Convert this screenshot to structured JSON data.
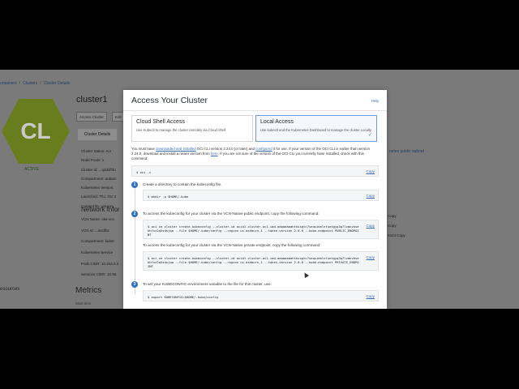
{
  "background": {
    "breadcrumb": [
      "ontainers",
      "/",
      "Clusters",
      "/",
      "Cluster Details"
    ],
    "avatar_initials": "CL",
    "status": "ACTIVE",
    "cluster_name": "cluster1",
    "buttons": [
      "Access Cluster",
      "Edit"
    ],
    "tab": "Cluster Details",
    "detail_rows": [
      "Cluster Status: Act",
      "Node Pools: 1",
      "Cluster Id: ...q2dsfhfu",
      "Compartment: aubam",
      "Kubernetes Version:",
      "Launched: Thu, Oct 2",
      "Created By: gregory"
    ],
    "network_title": "Network Infor",
    "network_rows": [
      "VCN Name: oke-vcn",
      "VCN Id: ...wcdfbz",
      "Compartment: kuber",
      "Kubernetes Service",
      "Pods CIDR: 10.244.0.0",
      "Services CIDR: 10.96."
    ],
    "metrics_title": "Metrics",
    "metrics_start": "Start time",
    "resources_title": "esources",
    "right_link": "netes public subnet",
    "right_rows": [
      "Copy",
      "Copy",
      "6443 Copy"
    ]
  },
  "modal": {
    "title": "Access Your Cluster",
    "help_label": "Help",
    "options": [
      {
        "title": "Cloud Shell Access",
        "desc": "Use Kubectl to manage the cluster remotely via Cloud Shell",
        "selected": false
      },
      {
        "title": "Local Access",
        "desc": "Use kubectl and the Kubernetes Dashboard to manage the cluster Locally.",
        "selected": true
      }
    ],
    "intro": {
      "p1": "You must have",
      "link1": "downloaded and installed",
      "p2": "OCI CLI version 2.24.0 (or later) and",
      "link2": "configured",
      "p3": "it for use. If your version of the OCI CLI is earlier than version 2.24.0, download and install a newer version from",
      "link3": "here",
      "p4": ". If you are not sure of the version of the OCI CLI you currently have installed, check with this command:"
    },
    "version_cmd": "$ oci -v",
    "copy_label": "Copy",
    "steps": [
      {
        "number": "1",
        "text": "Create a directory to contain the kubeconfig file.",
        "commands": [
          "$ mkdir -p $HOME/.kube"
        ]
      },
      {
        "number": "2",
        "text": "To access the kubeconfig for your cluster via the VCN-Native public endpoint, copy the following command:",
        "commands": [
          "$ oci ce cluster create-kubeconfig --cluster-id ocid1.cluster.oc1.iad.aaaaaaaahtksxgtc7seqsimnlnfuetgyq3q7lzmnvksekhfuz2q5sdsjqa --file $HOME/.kube/config --region us-ashburn-1 --token-version 2.0.0  --kube-endpoint PUBLIC_ENDPOINT"
        ],
        "text2": "To access the kubeconfig for your cluster via the VCN-Native private endpoint, copy the following command:",
        "commands2": [
          "$ oci ce cluster create-kubeconfig --cluster-id ocid1.cluster.oc1.iad.aaaaaaaahtksxgtc7seqsimnlnfuetgyq3q7lzmnvksekhfuz2q5sdsjqa --file $HOME/.kube/config --region us-ashburn-1 --token-version 2.0.0  --kube-endpoint PRIVATE_ENDPOINT"
        ]
      },
      {
        "number": "3",
        "text": "To set your KUBECONFIG environment variable to the file for this cluster, use:",
        "commands": [
          "$ export KUBECONFIG=$HOME/.kube/config"
        ]
      }
    ]
  },
  "colors": {
    "accent": "#2f6fbf",
    "link": "#3a6db0",
    "avatar": "#6a7d1e"
  }
}
